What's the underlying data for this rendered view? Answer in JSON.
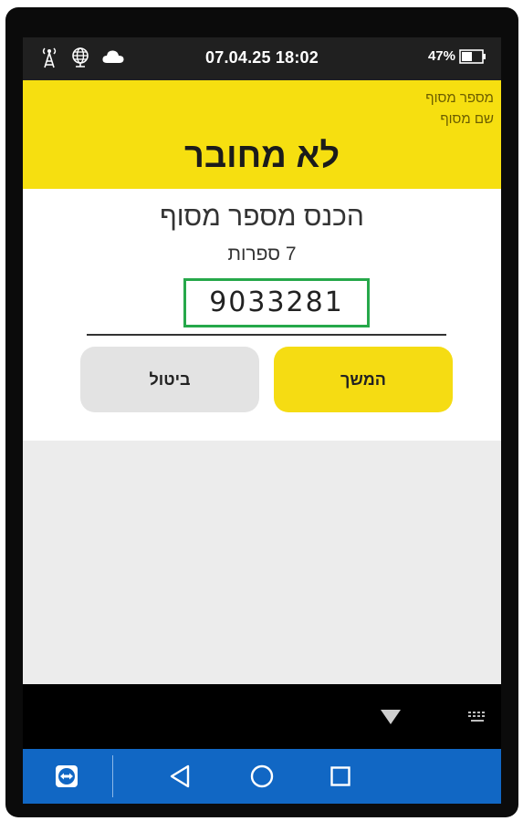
{
  "status_bar": {
    "icons": [
      "antenna-icon",
      "globe-icon",
      "cloud-icon",
      "battery-icon"
    ],
    "datetime": "07.04.25 18:02",
    "battery_percent": "47%"
  },
  "header": {
    "terminal_number_label": "מספר מסוף",
    "terminal_name_label": "שם מסוף",
    "status_title": "לא מחובר"
  },
  "form": {
    "prompt": "הכנס מספר מסוף",
    "hint": "7 ספרות",
    "terminal_number_value": "9033281",
    "continue_label": "המשך",
    "cancel_label": "ביטול"
  },
  "navigation": {
    "icons": [
      "teamviewer-icon",
      "back-icon",
      "home-icon",
      "recent-apps-icon",
      "hide-keyboard-icon",
      "keyboard-icon"
    ]
  },
  "colors": {
    "accent_yellow": "#f6df10",
    "highlight_green": "#26a84a",
    "nav_blue": "#1167c4"
  }
}
